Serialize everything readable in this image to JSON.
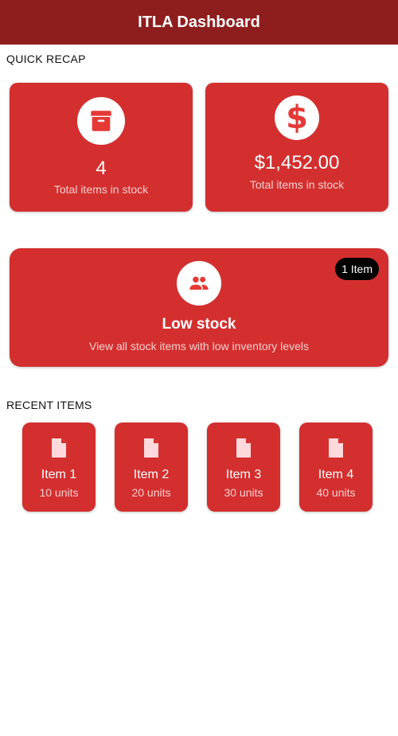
{
  "appbar": {
    "title": "ITLA Dashboard"
  },
  "recap": {
    "section_label": "QUICK RECAP",
    "stock_card": {
      "icon": "archive-icon",
      "value": "4",
      "label": "Total items in stock"
    },
    "value_card": {
      "icon": "dollar-icon",
      "value": "$1,452.00",
      "label": "Total items in stock"
    }
  },
  "low_stock": {
    "icon": "people-icon",
    "badge": "1 Item",
    "title": "Low stock",
    "description": "View all stock items with low inventory levels"
  },
  "recent": {
    "section_label": "RECENT ITEMS",
    "items": [
      {
        "name": "Item 1",
        "units": "10 units",
        "icon": "document-icon"
      },
      {
        "name": "Item 2",
        "units": "20 units",
        "icon": "document-icon"
      },
      {
        "name": "Item 3",
        "units": "30 units",
        "icon": "document-icon"
      },
      {
        "name": "Item 4",
        "units": "40 units",
        "icon": "document-icon"
      }
    ]
  },
  "colors": {
    "appbar": "#8e1e1e",
    "card": "#d32f2f",
    "badge": "#000000",
    "icon_accent": "#e53935",
    "icon_light": "#ffd9dc"
  }
}
